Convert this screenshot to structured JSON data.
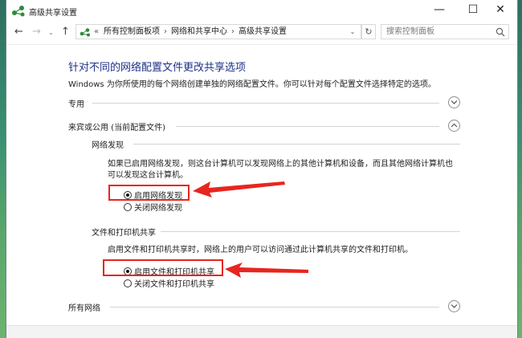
{
  "window": {
    "title": "高级共享设置",
    "controls": {
      "minimize": "—",
      "maximize": "☐",
      "close": "✕"
    }
  },
  "nav": {
    "back": "←",
    "forward": "→",
    "recent": "⌄",
    "up": "↑",
    "breadcrumb": [
      "所有控制面板项",
      "网络和共享中心",
      "高级共享设置"
    ],
    "breadcrumb_prefix": "«",
    "refresh": "↻",
    "search_placeholder": "搜索控制面板"
  },
  "content": {
    "title": "针对不同的网络配置文件更改共享选项",
    "description": "Windows 为你所使用的每个网络创建单独的网络配置文件。你可以针对每个配置文件选择特定的选项。",
    "sections": {
      "private": {
        "label": "专用",
        "state": "collapsed"
      },
      "guest_public": {
        "label": "来宾或公用 (当前配置文件)",
        "state": "expanded"
      },
      "all_networks": {
        "label": "所有网络",
        "state": "collapsed"
      }
    },
    "network_discovery": {
      "heading": "网络发现",
      "text_line1": "如果已启用网络发现，则这台计算机可以发现网络上的其他计算机和设备，而且其他网络计算机也",
      "text_line2": "可以发现这台计算机。",
      "options": [
        {
          "label": "启用网络发现",
          "checked": true
        },
        {
          "label": "关闭网络发现",
          "checked": false
        }
      ]
    },
    "file_printer_sharing": {
      "heading": "文件和打印机共享",
      "text": "启用文件和打印机共享时，网络上的用户可以访问通过此计算机共享的文件和打印机。",
      "options": [
        {
          "label": "启用文件和打印机共享",
          "checked": true
        },
        {
          "label": "关闭文件和打印机共享",
          "checked": false
        }
      ]
    }
  },
  "colors": {
    "title_blue": "#1e3287",
    "annotation_red": "#e8251f",
    "desktop_green": "#3a8f72"
  }
}
